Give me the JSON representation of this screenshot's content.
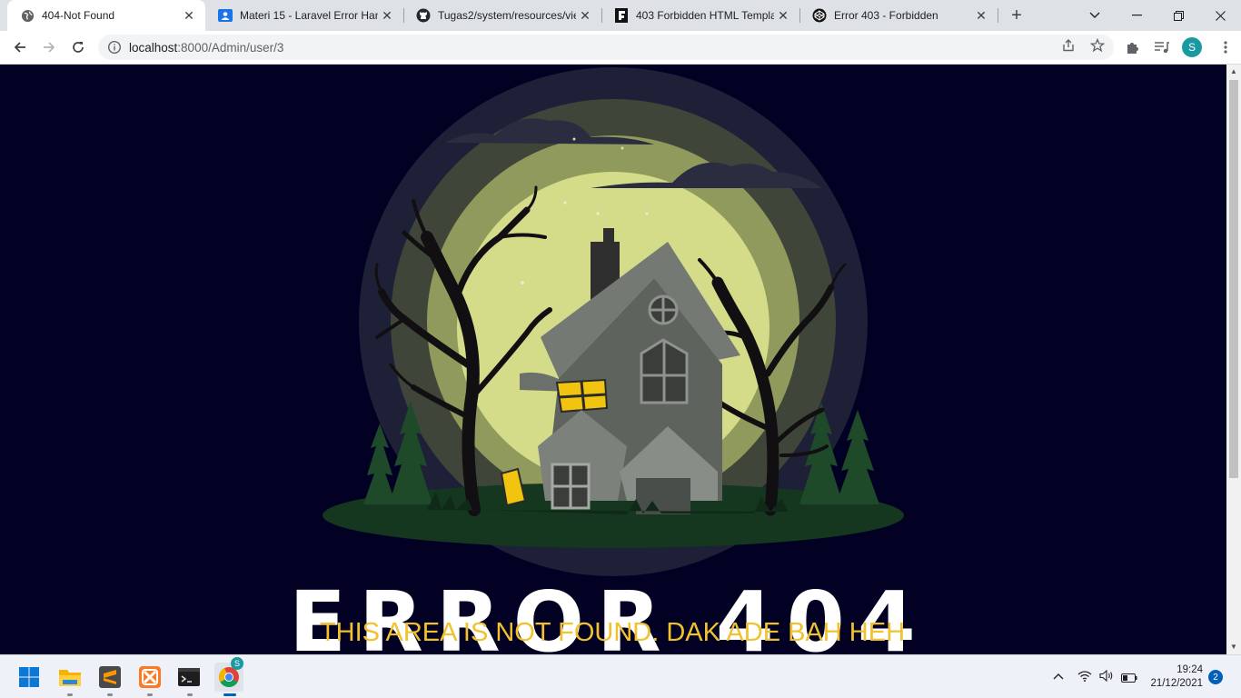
{
  "browser": {
    "tabs": [
      {
        "title": "404-Not Found",
        "icon": "globe-icon",
        "active": true
      },
      {
        "title": "Materi 15 - Laravel Error Han",
        "icon": "classroom-icon",
        "active": false
      },
      {
        "title": "Tugas2/system/resources/vie",
        "icon": "github-icon",
        "active": false
      },
      {
        "title": "403 Forbidden HTML Templa",
        "icon": "template-site-icon",
        "active": false
      },
      {
        "title": "Error 403 - Forbidden",
        "icon": "codepen-icon",
        "active": false
      }
    ],
    "close_glyph": "✕",
    "new_tab_glyph": "+",
    "url_host": "localhost",
    "url_rest": ":8000/Admin/user/3",
    "profile_initial": "S"
  },
  "page": {
    "error_title": "ERROR 404",
    "error_subtitle": "THIS AREA IS NOT FOUND. DAK ADE BAH HEH",
    "colors": {
      "background": "#020124",
      "moon": "#d4dc8a",
      "title": "#ffffff",
      "subtitle": "#f2c12e"
    }
  },
  "taskbar": {
    "apps": [
      "windows-start-icon",
      "file-explorer-icon",
      "sublime-text-icon",
      "xampp-icon",
      "terminal-icon",
      "chrome-icon"
    ],
    "chrome_badge": "S",
    "time": "19:24",
    "date": "21/12/2021",
    "notification_count": "2"
  }
}
